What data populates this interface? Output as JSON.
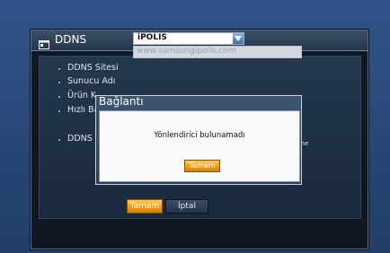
{
  "window": {
    "title": "DDNS",
    "icon": "window-icon"
  },
  "form": {
    "rows": [
      {
        "label": "DDNS Sitesi"
      },
      {
        "label": "Sunucu Adı"
      },
      {
        "label": "Ürün K"
      },
      {
        "label": "Hızlı Ba"
      },
      {
        "label": "DDNS s"
      }
    ],
    "site_select_value": "iPOLIS",
    "server_value": "www.samsungipolls.com",
    "truncated_suffix": "me"
  },
  "footer": {
    "ok_label": "Tamam",
    "cancel_label": "İptal"
  },
  "dialog": {
    "title": "Bağlantı",
    "message": "Yönlendirici bulunamadı",
    "ok_label": "Tamam"
  },
  "colors": {
    "accent": "#f29c12",
    "background": "#2b4c7e",
    "window": "#0f1822"
  }
}
